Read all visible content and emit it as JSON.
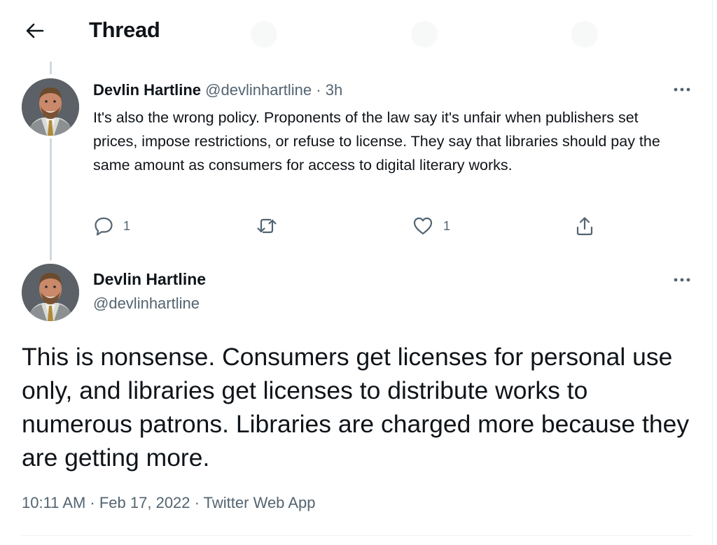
{
  "header": {
    "title": "Thread",
    "back_icon": "arrow-left-icon"
  },
  "parent_tweet": {
    "author_name": "Devlin Hartline",
    "author_handle": "@devlinhartline",
    "separator": "·",
    "time_ago": "3h",
    "text": "It's also the wrong policy. Proponents of the law say it's unfair when publishers set prices, impose restrictions, or refuse to license. They say that libraries should pay the same amount as consumers for access to digital literary works.",
    "actions": {
      "reply_count": "1",
      "retweet_count": "",
      "like_count": "1"
    }
  },
  "main_tweet": {
    "author_name": "Devlin Hartline",
    "author_handle": "@devlinhartline",
    "text": "This is nonsense. Consumers get licenses for personal use only, and libraries get licenses to distribute works to numerous patrons. Libraries are charged more because they are getting more.",
    "timestamp": "10:11 AM · Feb 17, 2022 · Twitter Web App"
  },
  "colors": {
    "text_primary": "#0f1419",
    "text_secondary": "#536471",
    "thread_line": "#cfd9de",
    "divider": "#eff3f4"
  }
}
